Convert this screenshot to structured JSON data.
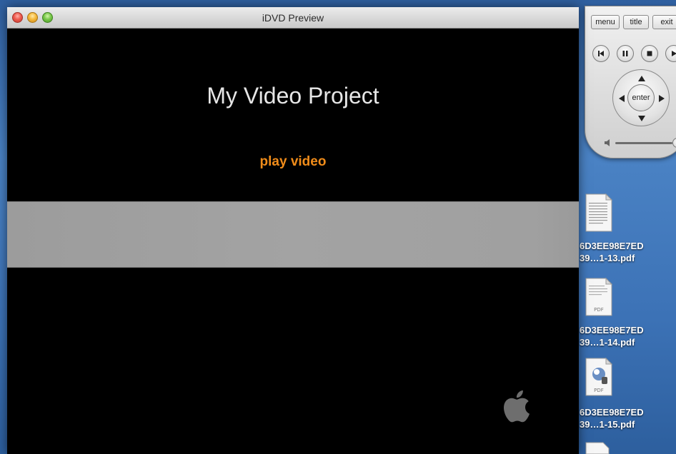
{
  "window": {
    "title": "iDVD Preview"
  },
  "menu": {
    "title": "My Video Project",
    "play_label": "play video"
  },
  "remote": {
    "menu_label": "menu",
    "title_label": "title",
    "exit_label": "exit",
    "enter_label": "enter"
  },
  "desktop_files": [
    {
      "name_line1": "6D3EE98E7ED",
      "name_line2": "39…1-13.pdf",
      "icon": "pdf-document-icon"
    },
    {
      "name_line1": "6D3EE98E7ED",
      "name_line2": "39…1-14.pdf",
      "icon": "pdf-document-icon"
    },
    {
      "name_line1": "6D3EE98E7ED",
      "name_line2": "39…1-15.pdf",
      "icon": "pdf-preview-icon"
    }
  ],
  "colors": {
    "play_link": "#f08c1a",
    "title_text": "#e6e6e6",
    "band": "#a0a0a0"
  }
}
